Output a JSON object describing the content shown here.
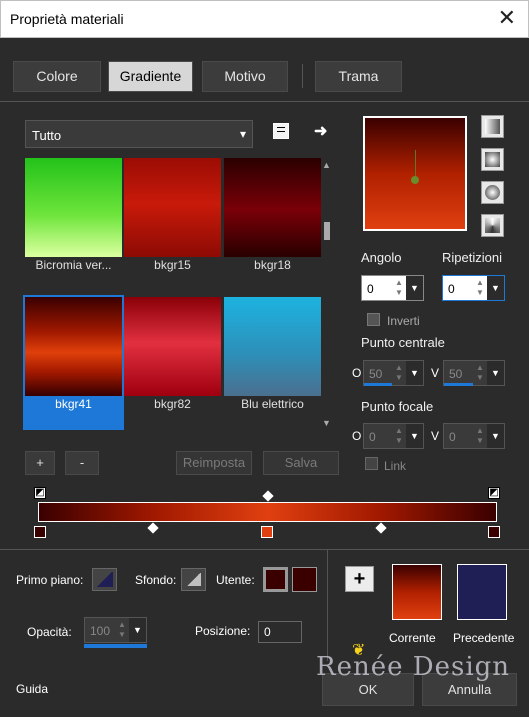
{
  "window": {
    "title": "Proprietà materiali",
    "close_glyph": "✕"
  },
  "tabs": [
    {
      "label": "Colore",
      "selected": false
    },
    {
      "label": "Gradiente",
      "selected": true
    },
    {
      "label": "Motivo",
      "selected": false
    },
    {
      "label": "Trama",
      "selected": false
    }
  ],
  "category": {
    "value": "Tutto",
    "dropdown_glyph": "▾"
  },
  "gradients": [
    {
      "label": "Bicromia ver...",
      "selected": false
    },
    {
      "label": "bkgr15",
      "selected": false
    },
    {
      "label": "bkgr18",
      "selected": false
    },
    {
      "label": "bkgr41",
      "selected": true
    },
    {
      "label": "bkgr82",
      "selected": false
    },
    {
      "label": "Blu elettrico",
      "selected": false
    }
  ],
  "list_buttons": {
    "add": "+",
    "remove": "-",
    "reset": "Reimposta",
    "save": "Salva"
  },
  "angle": {
    "label": "Angolo",
    "value": "0"
  },
  "repeats": {
    "label": "Ripetizioni",
    "value": "0"
  },
  "invert": {
    "label": "Inverti",
    "checked": false
  },
  "center": {
    "label": "Punto centrale",
    "h_label": "O",
    "h_value": "50",
    "v_label": "V",
    "v_value": "50"
  },
  "focal": {
    "label": "Punto focale",
    "h_label": "O",
    "h_value": "0",
    "v_label": "V",
    "v_value": "0"
  },
  "link": {
    "label": "Link",
    "checked": false
  },
  "fg": {
    "label": "Primo piano:"
  },
  "bg": {
    "label": "Sfondo:"
  },
  "user": {
    "label": "Utente:",
    "color": "#3a0000"
  },
  "opacity": {
    "label": "Opacità:",
    "value": "100",
    "level": 1.0
  },
  "position": {
    "label": "Posizione:",
    "value": "0"
  },
  "current": {
    "label": "Corrente"
  },
  "previous": {
    "label": "Precedente",
    "color": "#1f1f55"
  },
  "add_swatch": "+",
  "watermark": "Renée Design",
  "footer": {
    "help": "Guida",
    "ok": "OK",
    "cancel": "Annulla"
  },
  "colors": {
    "accent": "#1e78d7",
    "gradient_dark": "#3a0000",
    "gradient_bright": "#e04010"
  }
}
